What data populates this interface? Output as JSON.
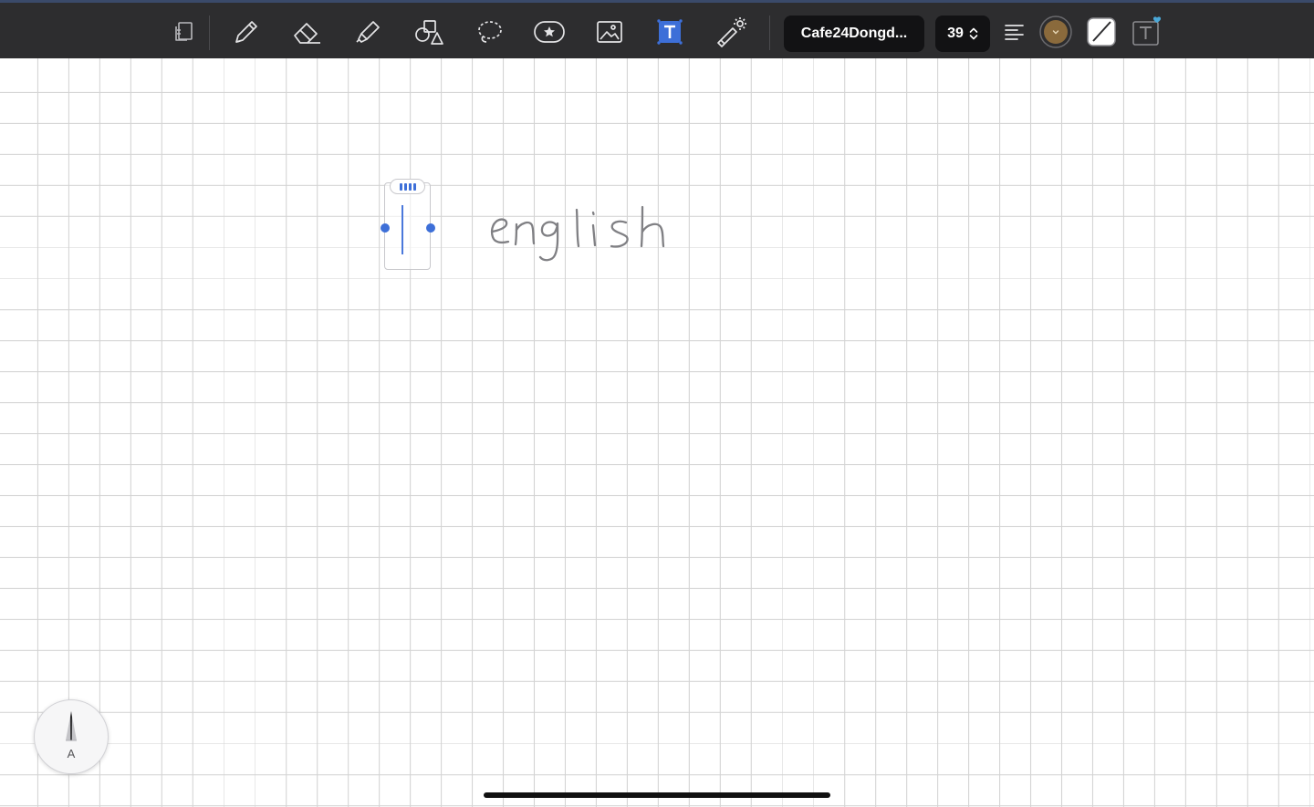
{
  "toolbar": {
    "tools": [
      {
        "id": "page-layout",
        "icon": "page-layout-icon"
      },
      {
        "id": "pen",
        "icon": "pen-icon"
      },
      {
        "id": "eraser",
        "icon": "eraser-icon"
      },
      {
        "id": "highlighter",
        "icon": "highlighter-icon"
      },
      {
        "id": "shapes",
        "icon": "shapes-icon"
      },
      {
        "id": "lasso",
        "icon": "lasso-icon"
      },
      {
        "id": "sticker",
        "icon": "star-sticker-icon"
      },
      {
        "id": "image",
        "icon": "image-icon"
      },
      {
        "id": "text",
        "icon": "text-tool-icon",
        "selected": true
      },
      {
        "id": "laser-pointer",
        "icon": "laser-pointer-icon"
      }
    ],
    "font_name": "Cafe24Dongd...",
    "font_size": "39",
    "text_color": "#8a6a3c",
    "accent": "#3d6fd8"
  },
  "canvas": {
    "grid": true,
    "grid_color": "#d3d3d3",
    "handwritten_text": "english"
  },
  "pencil_shortcut": {
    "label": "A"
  }
}
